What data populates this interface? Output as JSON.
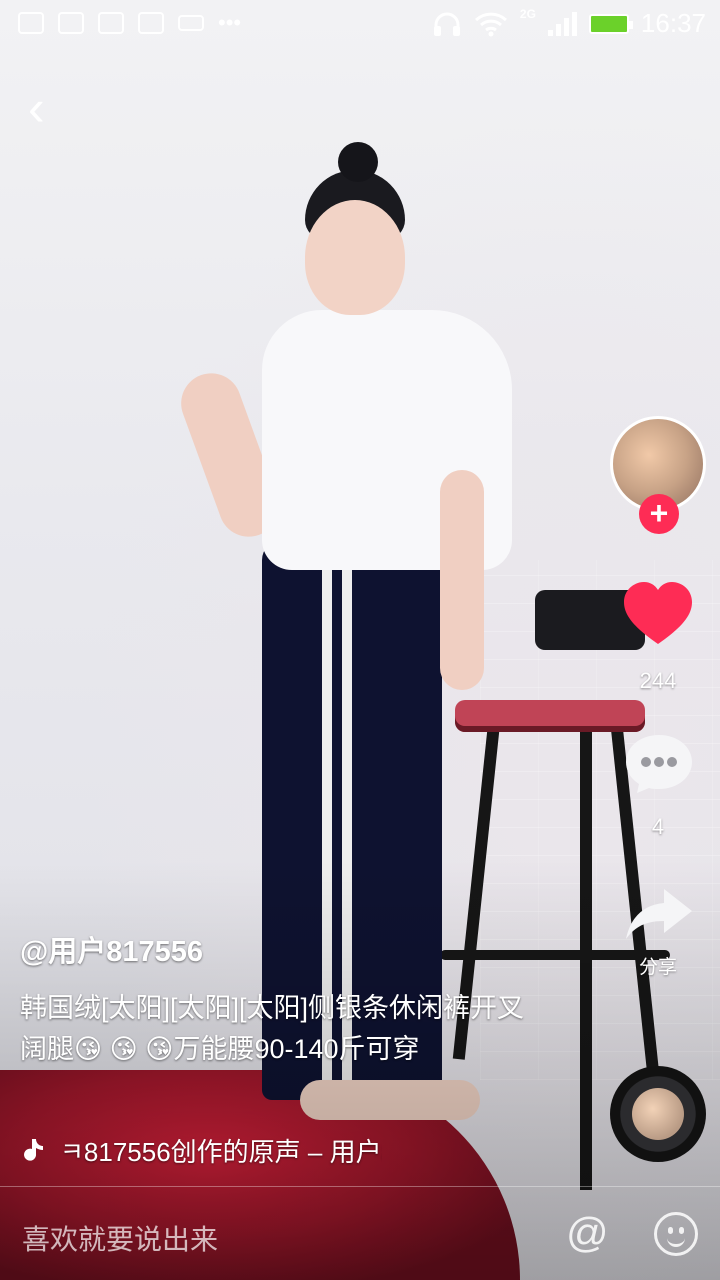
{
  "status_bar": {
    "time": "16:37",
    "network": "2G",
    "battery": "charging",
    "icons": [
      "gallery-icon",
      "huawei-icon",
      "huawei-icon",
      "huawei-icon",
      "keyboard-icon",
      "more-icon",
      "headphones-icon",
      "wifi-icon",
      "signal-icon",
      "battery-icon"
    ]
  },
  "nav": {
    "back_icon": "back-arrow-icon"
  },
  "right_rail": {
    "follow_icon": "plus-icon",
    "likes": "244",
    "comments": "4",
    "share_label": "分享"
  },
  "video": {
    "username": "@用户817556",
    "caption": "韩国绒[太阳][太阳][太阳]侧银条休闲裤开叉阔腿😘 😘 😘万能腰90-140斤可穿",
    "music": "ㅋ817556创作的原声 – 用户817556"
  },
  "comment_bar": {
    "placeholder": "喜欢就要说出来",
    "at_symbol": "@"
  },
  "colors": {
    "accent": "#fe2c55"
  }
}
